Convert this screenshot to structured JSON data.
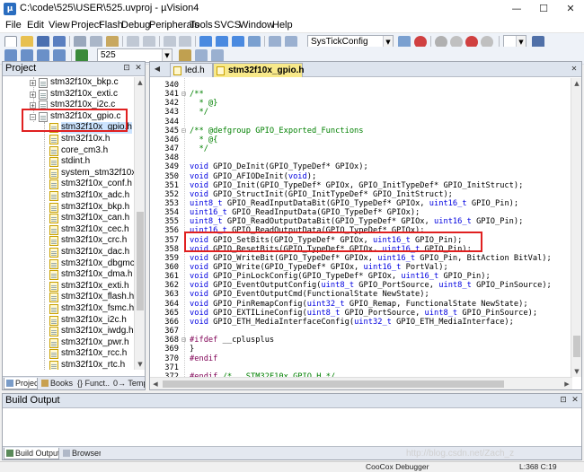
{
  "window": {
    "title": "C:\\code\\525\\USER\\525.uvproj - µVision4",
    "min": "—",
    "max": "☐",
    "close": "✕"
  },
  "menu": [
    "File",
    "Edit",
    "View",
    "Project",
    "Flash",
    "Debug",
    "Peripherals",
    "Tools",
    "SVCS",
    "Window",
    "Help"
  ],
  "toolbar1": {
    "combo": "SysTickConfig"
  },
  "toolbar2": {
    "target": "525"
  },
  "project_panel": {
    "title": "Project",
    "files": [
      {
        "name": "stm32f10x_bkp.c",
        "kind": "c",
        "expandable": true
      },
      {
        "name": "stm32f10x_exti.c",
        "kind": "c",
        "expandable": true
      },
      {
        "name": "stm32f10x_i2c.c",
        "kind": "c",
        "expandable": true
      },
      {
        "name": "stm32f10x_gpio.c",
        "kind": "c",
        "expandable": true,
        "expanded": true
      },
      {
        "name": "stm32f10x_gpio.h",
        "kind": "h",
        "child": true,
        "selected": true
      },
      {
        "name": "stm32f10x.h",
        "kind": "h",
        "child": true
      },
      {
        "name": "core_cm3.h",
        "kind": "h",
        "child": true
      },
      {
        "name": "stdint.h",
        "kind": "h",
        "child": true
      },
      {
        "name": "system_stm32f10x.h",
        "kind": "h",
        "child": true
      },
      {
        "name": "stm32f10x_conf.h",
        "kind": "h",
        "child": true
      },
      {
        "name": "stm32f10x_adc.h",
        "kind": "h",
        "child": true
      },
      {
        "name": "stm32f10x_bkp.h",
        "kind": "h",
        "child": true
      },
      {
        "name": "stm32f10x_can.h",
        "kind": "h",
        "child": true
      },
      {
        "name": "stm32f10x_cec.h",
        "kind": "h",
        "child": true
      },
      {
        "name": "stm32f10x_crc.h",
        "kind": "h",
        "child": true
      },
      {
        "name": "stm32f10x_dac.h",
        "kind": "h",
        "child": true
      },
      {
        "name": "stm32f10x_dbgmcu.h",
        "kind": "h",
        "child": true
      },
      {
        "name": "stm32f10x_dma.h",
        "kind": "h",
        "child": true
      },
      {
        "name": "stm32f10x_exti.h",
        "kind": "h",
        "child": true
      },
      {
        "name": "stm32f10x_flash.h",
        "kind": "h",
        "child": true
      },
      {
        "name": "stm32f10x_fsmc.h",
        "kind": "h",
        "child": true
      },
      {
        "name": "stm32f10x_i2c.h",
        "kind": "h",
        "child": true
      },
      {
        "name": "stm32f10x_iwdg.h",
        "kind": "h",
        "child": true
      },
      {
        "name": "stm32f10x_pwr.h",
        "kind": "h",
        "child": true
      },
      {
        "name": "stm32f10x_rcc.h",
        "kind": "h",
        "child": true
      },
      {
        "name": "stm32f10x_rtc.h",
        "kind": "h",
        "child": true
      }
    ],
    "tabs": [
      "Project",
      "Books",
      "{} Funct...",
      "0→ Templ..."
    ]
  },
  "editor": {
    "tabs": [
      "led.h",
      "stm32f10x_gpio.h"
    ],
    "lines": [
      {
        "n": "340",
        "fold": "",
        "t": ""
      },
      {
        "n": "341",
        "fold": "⊟",
        "t": "/**"
      },
      {
        "n": "342",
        "fold": "",
        "t": "  * @}"
      },
      {
        "n": "343",
        "fold": "",
        "t": "  */"
      },
      {
        "n": "344",
        "fold": "",
        "t": ""
      },
      {
        "n": "345",
        "fold": "⊟",
        "t": "/** @defgroup GPIO_Exported_Functions"
      },
      {
        "n": "346",
        "fold": "",
        "t": "  * @{"
      },
      {
        "n": "347",
        "fold": "",
        "t": "  */"
      },
      {
        "n": "348",
        "fold": "",
        "t": ""
      },
      {
        "n": "349",
        "fold": "",
        "t": "void GPIO_DeInit(GPIO_TypeDef* GPIOx);"
      },
      {
        "n": "350",
        "fold": "",
        "t": "void GPIO_AFIODeInit(void);"
      },
      {
        "n": "351",
        "fold": "",
        "t": "void GPIO_Init(GPIO_TypeDef* GPIOx, GPIO_InitTypeDef* GPIO_InitStruct);"
      },
      {
        "n": "352",
        "fold": "",
        "t": "void GPIO_StructInit(GPIO_InitTypeDef* GPIO_InitStruct);"
      },
      {
        "n": "353",
        "fold": "",
        "t": "uint8_t GPIO_ReadInputDataBit(GPIO_TypeDef* GPIOx, uint16_t GPIO_Pin);"
      },
      {
        "n": "354",
        "fold": "",
        "t": "uint16_t GPIO_ReadInputData(GPIO_TypeDef* GPIOx);"
      },
      {
        "n": "355",
        "fold": "",
        "t": "uint8_t GPIO_ReadOutputDataBit(GPIO_TypeDef* GPIOx, uint16_t GPIO_Pin);"
      },
      {
        "n": "356",
        "fold": "",
        "t": "uint16_t GPIO_ReadOutputData(GPIO_TypeDef* GPIOx);"
      },
      {
        "n": "357",
        "fold": "",
        "t": "void GPIO_SetBits(GPIO_TypeDef* GPIOx, uint16_t GPIO_Pin);"
      },
      {
        "n": "358",
        "fold": "",
        "t": "void GPIO_ResetBits(GPIO_TypeDef* GPIOx, uint16_t GPIO_Pin);"
      },
      {
        "n": "359",
        "fold": "",
        "t": "void GPIO_WriteBit(GPIO_TypeDef* GPIOx, uint16_t GPIO_Pin, BitAction BitVal);"
      },
      {
        "n": "360",
        "fold": "",
        "t": "void GPIO_Write(GPIO_TypeDef* GPIOx, uint16_t PortVal);"
      },
      {
        "n": "361",
        "fold": "",
        "t": "void GPIO_PinLockConfig(GPIO_TypeDef* GPIOx, uint16_t GPIO_Pin);"
      },
      {
        "n": "362",
        "fold": "",
        "t": "void GPIO_EventOutputConfig(uint8_t GPIO_PortSource, uint8_t GPIO_PinSource);"
      },
      {
        "n": "363",
        "fold": "",
        "t": "void GPIO_EventOutputCmd(FunctionalState NewState);"
      },
      {
        "n": "364",
        "fold": "",
        "t": "void GPIO_PinRemapConfig(uint32_t GPIO_Remap, FunctionalState NewState);"
      },
      {
        "n": "365",
        "fold": "",
        "t": "void GPIO_EXTILineConfig(uint8_t GPIO_PortSource, uint8_t GPIO_PinSource);"
      },
      {
        "n": "366",
        "fold": "",
        "t": "void GPIO_ETH_MediaInterfaceConfig(uint32_t GPIO_ETH_MediaInterface);"
      },
      {
        "n": "367",
        "fold": "",
        "t": ""
      },
      {
        "n": "368",
        "fold": "⊟",
        "t": "#ifdef __cplusplus"
      },
      {
        "n": "369",
        "fold": "",
        "t": "}"
      },
      {
        "n": "370",
        "fold": "",
        "t": "#endif"
      },
      {
        "n": "371",
        "fold": "",
        "t": ""
      },
      {
        "n": "372",
        "fold": "",
        "t": "#endif /* __STM32F10x_GPIO_H */"
      }
    ]
  },
  "build_output": {
    "title": "Build Output",
    "tabs": [
      "Build Output",
      "Browser"
    ]
  },
  "status": {
    "debugger": "CooCox Debugger",
    "position": "L:368 C:19"
  },
  "watermark": "http://blog.csdn.net/Zach_z",
  "colors": {
    "highlight": "#e02020",
    "comment": "#008000",
    "keyword": "#0000e0"
  }
}
